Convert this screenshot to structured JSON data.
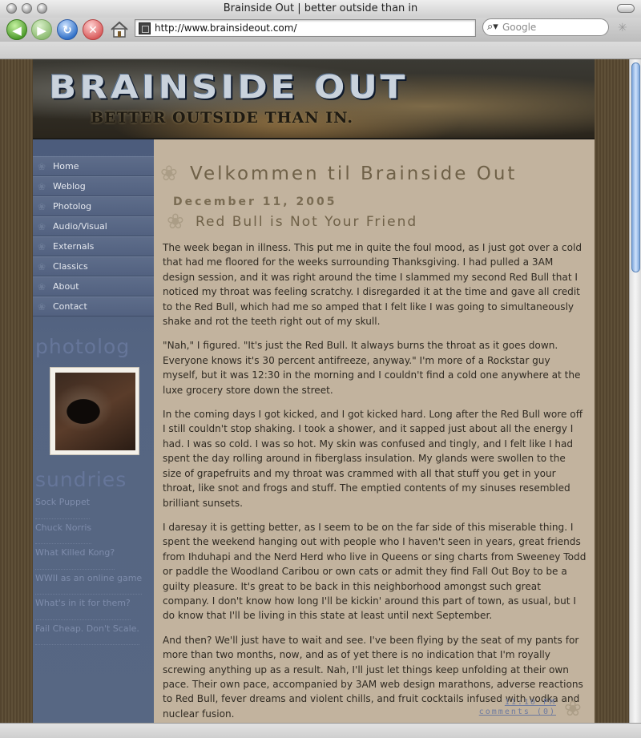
{
  "browser": {
    "window_title": "Brainside Out | better outside than in",
    "url": "http://www.brainsideout.com/",
    "search_placeholder": "Google"
  },
  "site": {
    "banner_title": "BRAINSIDE OUT",
    "banner_tagline": "BETTER OUTSIDE THAN IN."
  },
  "sidebar": {
    "nav": [
      "Home",
      "Weblog",
      "Photolog",
      "Audio/Visual",
      "Externals",
      "Classics",
      "About",
      "Contact"
    ],
    "photolog_heading": "photolog",
    "sundries_heading": "sundries",
    "sundries": [
      "Sock Puppet",
      "Chuck Norris",
      "What Killed Kong?",
      "WWII as an online game",
      "What's in it for them?",
      "Fail Cheap. Don't Scale."
    ]
  },
  "content": {
    "welcome": "Velkommen til Brainside Out",
    "date": "December 11, 2005",
    "post_title": "Red Bull is Not Your Friend",
    "paragraphs": [
      "The week began in illness. This put me in quite the foul mood, as I just got over a cold that had me floored for the weeks surrounding Thanksgiving. I had pulled a 3AM design session, and it was right around the time I slammed my second Red Bull that I noticed my throat was feeling scratchy. I disregarded it at the time and gave all credit to the Red Bull, which had me so amped that I felt like I was going to simultaneously shake and rot the teeth right out of my skull.",
      "\"Nah,\" I figured. \"It's just the Red Bull. It always burns the throat as it goes down. Everyone knows it's 30 percent antifreeze, anyway.\" I'm more of a Rockstar guy myself, but it was 12:30 in the morning and I couldn't find a cold one anywhere at the luxe grocery store down the street.",
      "In the coming days I got kicked, and I got kicked hard. Long after the Red Bull wore off I still couldn't stop shaking. I took a shower, and it sapped just about all the energy I had. I was so cold. I was so hot. My skin was confused and tingly, and I felt like I had spent the day rolling around in fiberglass insulation. My glands were swollen to the size of grapefruits and my throat was crammed with all that stuff you get in your throat, like snot and frogs and stuff. The emptied contents of my sinuses resembled brilliant sunsets.",
      "I daresay it is getting better, as I seem to be on the far side of this miserable thing. I spent the weekend hanging out with people who I haven't seen in years, great friends from Ihduhapi and the Nerd Herd who live in Queens or sing charts from Sweeney Todd or paddle the Woodland Caribou or own cats or admit they find Fall Out Boy to be a guilty pleasure. It's great to be back in this neighborhood amongst such great company. I don't know how long I'll be kickin' around this part of town, as usual, but I do know that I'll be living in this state at least until next September.",
      "And then? We'll just have to wait and see. I've been flying by the seat of my pants for more than two months, now, and as of yet there is no indication that I'm royally screwing anything up as a result. Nah, I'll just let things keep unfolding at their own pace. Their own pace, accompanied by 3AM web design marathons, adverse reactions to Red Bull, fever dreams and violent chills, and fruit cocktails infused with vodka and nuclear fusion."
    ],
    "time": "11:10 PM",
    "comments": "comments (0)"
  }
}
